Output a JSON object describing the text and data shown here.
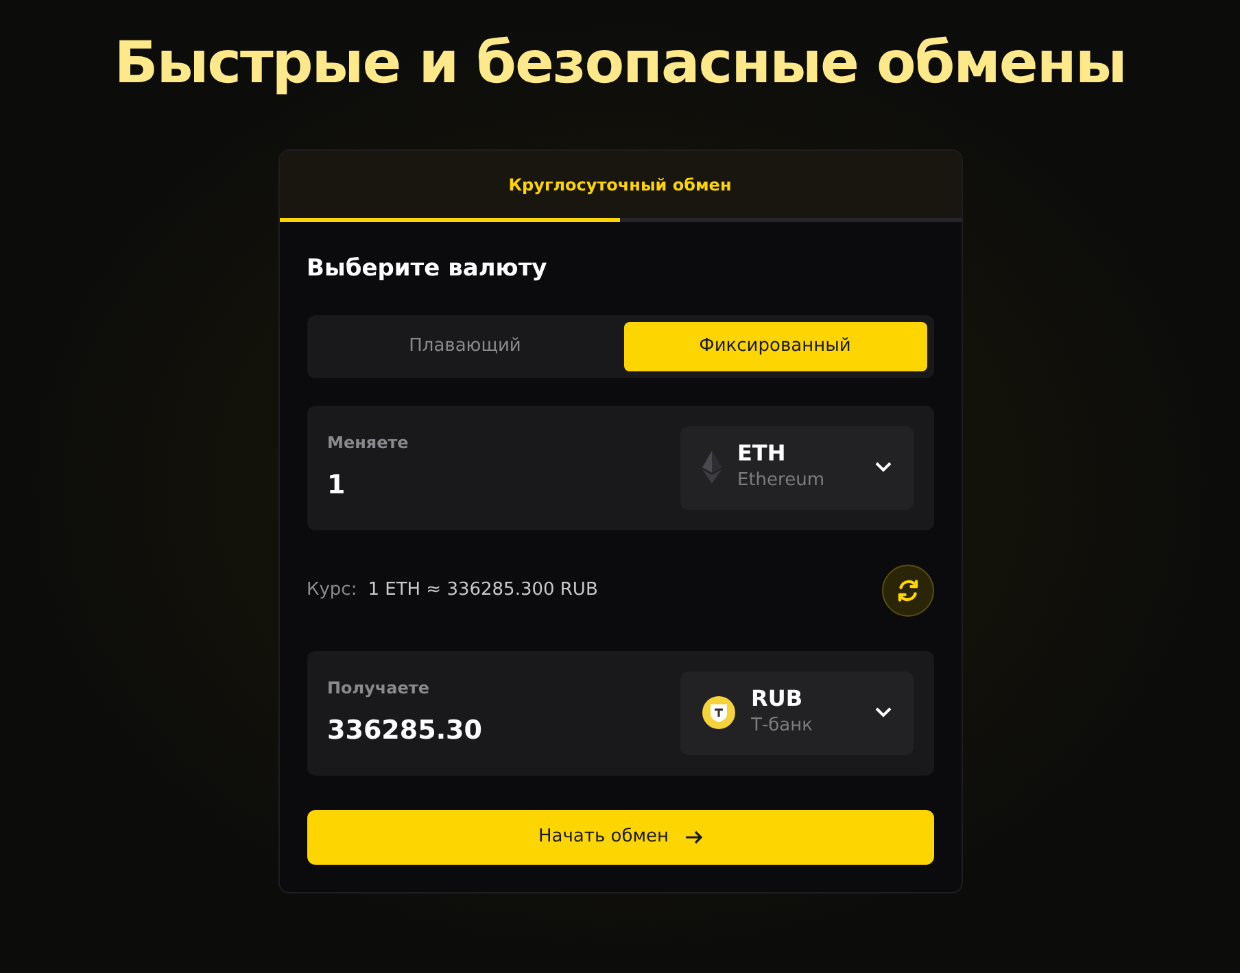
{
  "headline": "Быстрые и безопасные обмены",
  "tabs": [
    {
      "label": "Круглосуточный обмен",
      "selected": true
    }
  ],
  "heading": "Выберите валюту",
  "rate_modes": [
    {
      "label": "Плавающий",
      "selected": false
    },
    {
      "label": "Фиксированный",
      "selected": true
    }
  ],
  "send": {
    "label": "Меняете",
    "value": "1",
    "currency": {
      "code": "ETH",
      "name": "Ethereum",
      "kind": "eth"
    }
  },
  "rate": {
    "label": "Курс:",
    "value": "1 ETH ≈ 336285.300 RUB"
  },
  "receive": {
    "label": "Получаете",
    "value": "336285.30",
    "currency": {
      "code": "RUB",
      "name": "Т-банк",
      "kind": "bank"
    }
  },
  "submit": "Начать обмен"
}
